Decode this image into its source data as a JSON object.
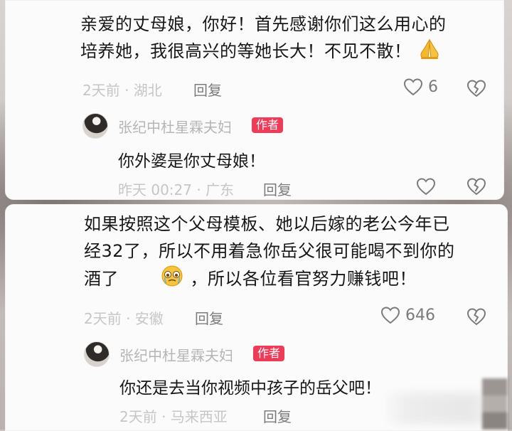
{
  "comments": [
    {
      "text_line1": "亲爱的丈母娘，你好！首先感谢你们这么用心的",
      "text_line2": "培养她，我很高兴的等她长大！不见不散！",
      "emoji": "pray-emoji",
      "time_location": "2天前 · 湖北",
      "reply_label": "回复",
      "like_count": "6",
      "author_reply": {
        "author": "张纪中杜星霖夫妇",
        "badge": "作者",
        "text": "你外婆是你丈母娘！",
        "time_location": "昨天 00:27 · 广东",
        "reply_label": "回复"
      }
    },
    {
      "text_line1": "如果按照这个父母模板、她以后嫁的老公今年已",
      "text_line2": "经32了，所以不用着急你岳父很可能喝不到你的",
      "text_line3_a": "酒了",
      "emoji": "crying-face-emoji",
      "text_line3_b": "，所以各位看官努力赚钱吧！",
      "time_location": "2天前 · 安徽",
      "reply_label": "回复",
      "like_count": "646",
      "author_reply": {
        "author": "张纪中杜星霖夫妇",
        "badge": "作者",
        "text": "你还是去当你视频中孩子的岳父吧！",
        "time_location": "2天前 · 马来西亚",
        "reply_label": "回复"
      }
    }
  ],
  "colors": {
    "badge_bg": "#ee3b57",
    "text": "#171717",
    "meta": "#9b9b9b",
    "card_bg": "#fbfbfb"
  }
}
